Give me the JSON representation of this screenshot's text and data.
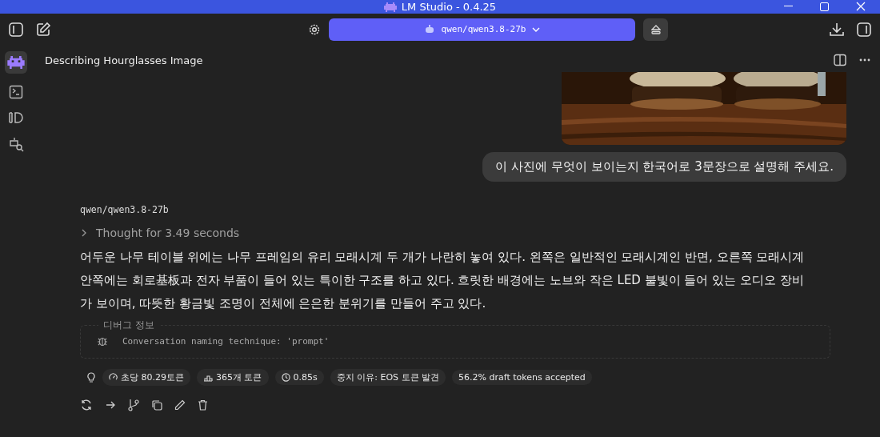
{
  "window": {
    "title": "LM Studio - 0.4.25"
  },
  "model_selector": {
    "label": "qwen/qwen3.8-27b"
  },
  "chat": {
    "title": "Describing Hourglasses Image"
  },
  "user_message": {
    "text": "이 사진에 무엇이 보이는지 한국어로 3문장으로 설명해 주세요."
  },
  "assistant_message": {
    "model": "qwen/qwen3.8-27b",
    "thought": {
      "label": "Thought for 3.49 seconds",
      "expanded": false
    },
    "text": "어두운 나무 테이블 위에는 나무 프레임의 유리 모래시계 두 개가 나란히 놓여 있다. 왼쪽은 일반적인 모래시계인 반면, 오른쪽 모래시계 안쪽에는 회로基板과 전자 부품이 들어 있는 특이한 구조를 하고 있다. 흐릿한 배경에는 노브와 작은 LED 불빛이 들어 있는 오디오 장비가 보이며, 따뜻한 황금빛 조명이 전체에 은은한 분위기를 만들어 주고 있다.",
    "debug": {
      "legend": "디버그 정보",
      "text": "Conversation naming technique: 'prompt'"
    },
    "stats": [
      {
        "kind": "speed",
        "text": "초당 80.29토큰"
      },
      {
        "kind": "tokens",
        "text": "365개 토큰"
      },
      {
        "kind": "time",
        "text": "0.85s"
      },
      {
        "kind": "plain",
        "text": "중지 이유: EOS 토큰 발견"
      },
      {
        "kind": "plain",
        "text": "56.2% draft tokens accepted"
      }
    ]
  }
}
